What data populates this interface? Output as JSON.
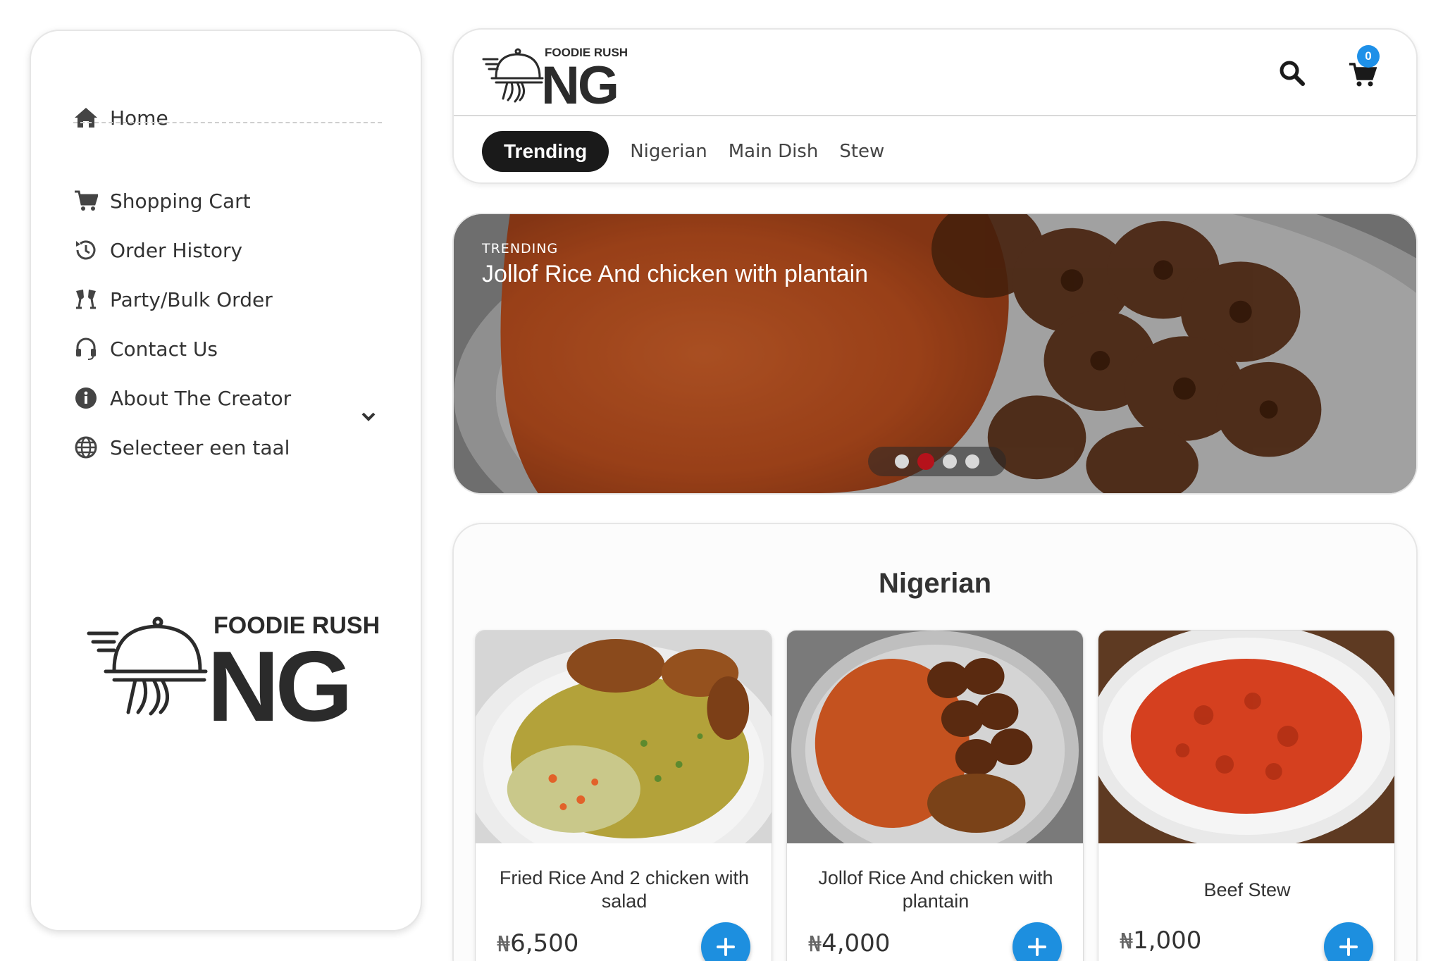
{
  "brand": {
    "small": "FOODIE RUSH",
    "big": "NG"
  },
  "sidebar": {
    "home": "Home",
    "items": [
      {
        "label": "Shopping Cart",
        "icon": "cart-icon"
      },
      {
        "label": "Order History",
        "icon": "history-icon"
      },
      {
        "label": "Party/Bulk Order",
        "icon": "party-glasses-icon"
      },
      {
        "label": "Contact Us",
        "icon": "headset-icon"
      },
      {
        "label": "About The Creator",
        "icon": "info-icon"
      }
    ],
    "language": "Selecteer een taal"
  },
  "header": {
    "cart_count": "0",
    "tabs": [
      "Trending",
      "Nigerian",
      "Main Dish",
      "Stew"
    ],
    "active_tab": "Trending"
  },
  "hero": {
    "tag": "TRENDING",
    "title": "Jollof Rice And chicken with plantain",
    "slide_count": 4,
    "active_slide": 2
  },
  "section": {
    "title": "Nigerian",
    "currency": "₦",
    "products": [
      {
        "name": "Fried Rice And 2 chicken with salad",
        "price": "6,500"
      },
      {
        "name": "Jollof Rice And chicken with plantain",
        "price": "4,000"
      },
      {
        "name": "Beef Stew",
        "price": "1,000"
      }
    ]
  },
  "colors": {
    "accent": "#1d8fdf",
    "active_dot": "#b5121b",
    "tab_active_bg": "#1a1a1a",
    "badge": "#1e90e8"
  }
}
